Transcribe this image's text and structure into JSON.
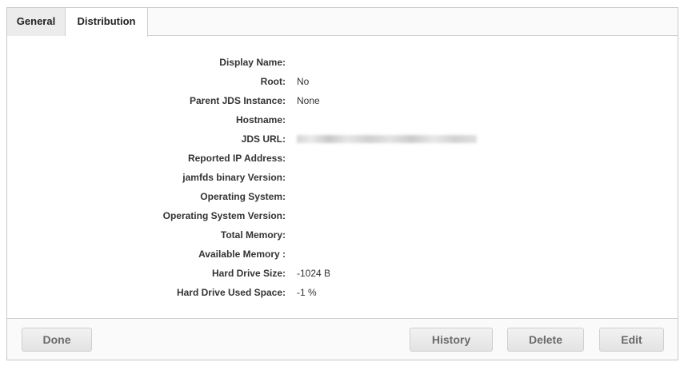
{
  "tabs": [
    {
      "label": "General",
      "active": true
    },
    {
      "label": "Distribution",
      "active": false
    }
  ],
  "fields": [
    {
      "label": "Display Name:",
      "value": ""
    },
    {
      "label": "Root:",
      "value": "No"
    },
    {
      "label": "Parent JDS Instance:",
      "value": "None"
    },
    {
      "label": "Hostname:",
      "value": ""
    },
    {
      "label": "JDS URL:",
      "value": "",
      "redacted": true
    },
    {
      "label": "Reported IP Address:",
      "value": ""
    },
    {
      "label": "jamfds binary Version:",
      "value": ""
    },
    {
      "label": "Operating System:",
      "value": ""
    },
    {
      "label": "Operating System Version:",
      "value": ""
    },
    {
      "label": "Total Memory:",
      "value": ""
    },
    {
      "label": "Available Memory :",
      "value": ""
    },
    {
      "label": "Hard Drive Size:",
      "value": "-1024 B"
    },
    {
      "label": "Hard Drive Used Space:",
      "value": "-1 %"
    }
  ],
  "buttons": {
    "done": "Done",
    "history": "History",
    "delete": "Delete",
    "edit": "Edit"
  }
}
